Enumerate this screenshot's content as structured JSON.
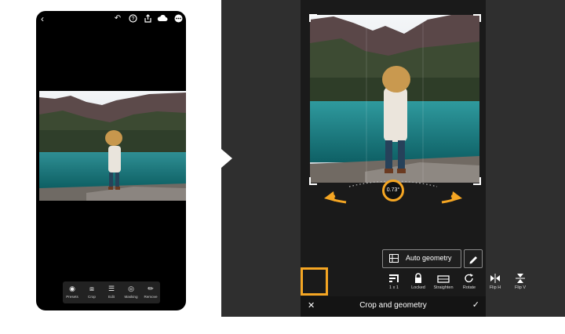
{
  "left_phone": {
    "toolbar": [
      {
        "label": "Presets",
        "icon": "presets-icon"
      },
      {
        "label": "Crop",
        "icon": "crop-icon"
      },
      {
        "label": "Edit",
        "icon": "edit-sliders-icon"
      },
      {
        "label": "Masking",
        "icon": "masking-icon"
      },
      {
        "label": "Remove",
        "icon": "eraser-icon"
      }
    ]
  },
  "right_phone": {
    "dial_value": "0.73°",
    "auto_geometry_label": "Auto geometry",
    "tools": [
      {
        "label": "1 x 1",
        "icon": "aspect-ratio-icon"
      },
      {
        "label": "Locked",
        "icon": "lock-icon"
      },
      {
        "label": "Straighten",
        "icon": "straighten-icon"
      },
      {
        "label": "Rotate",
        "icon": "rotate-icon"
      },
      {
        "label": "Flip H",
        "icon": "flip-horizontal-icon"
      },
      {
        "label": "Flip V",
        "icon": "flip-vertical-icon"
      }
    ],
    "panel_title": "Crop and geometry"
  },
  "colors": {
    "highlight": "#f5a623",
    "panel_bg": "#2f2f2f"
  }
}
